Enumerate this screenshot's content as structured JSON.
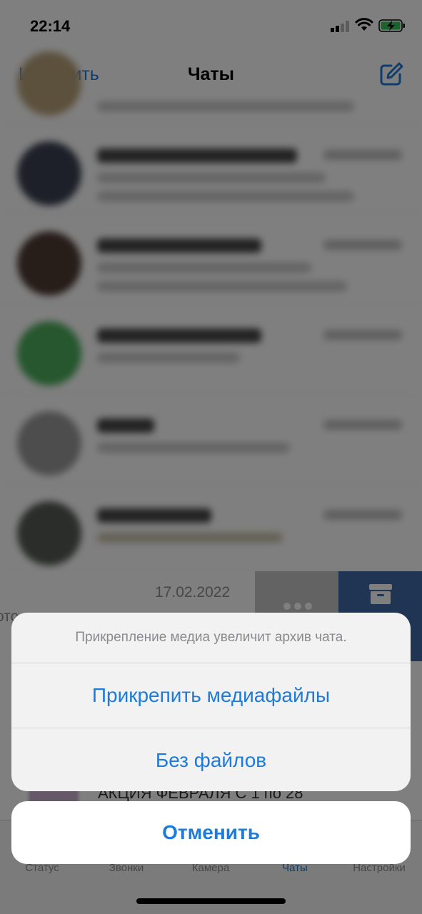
{
  "status_bar": {
    "time": "22:14"
  },
  "nav": {
    "edit_label": "Изменить",
    "title": "Чаты"
  },
  "swipe_row": {
    "date": "17.02.2022",
    "cut_text": "ото"
  },
  "promo_row": {
    "text": "АКЦИЯ ФЕВРАЛЯ С 1 по 28"
  },
  "tabs": [
    {
      "label": "Статус"
    },
    {
      "label": "Звонки"
    },
    {
      "label": "Камера"
    },
    {
      "label": "Чаты"
    },
    {
      "label": "Настройки"
    }
  ],
  "action_sheet": {
    "message": "Прикрепление медиа увеличит архив чата.",
    "attach_label": "Прикрепить медиафайлы",
    "no_files_label": "Без файлов",
    "cancel_label": "Отменить"
  },
  "colors": {
    "accent": "#1f7bd9",
    "archive": "#3f6aa6",
    "more": "#c6c6c9",
    "tab_active": "#1f7bd9",
    "tab_inactive": "#8e8e93"
  }
}
